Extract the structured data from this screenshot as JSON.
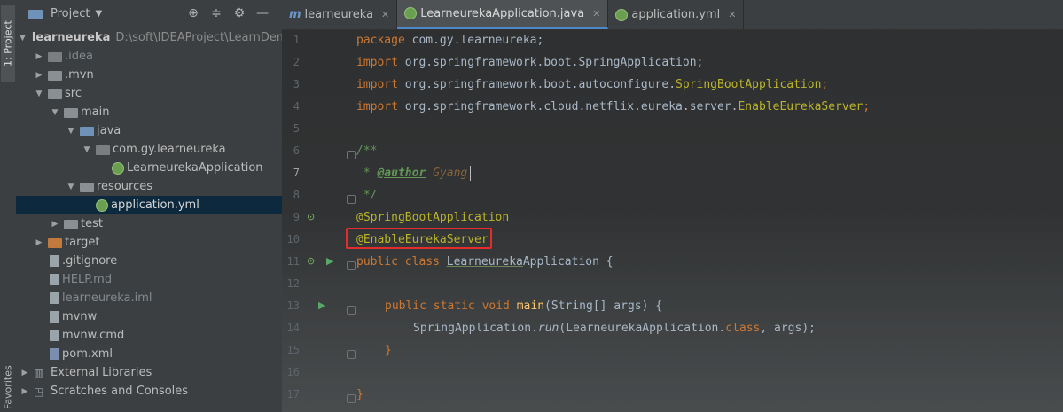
{
  "left_strip": {
    "project_tab": "1: Project",
    "favorites_tab": "Favorites"
  },
  "project_panel": {
    "title": "Project",
    "tree": [
      {
        "label": "learneureka",
        "path": "D:\\soft\\IDEAProject\\LearnDemo",
        "icon": "module-folder-icon"
      },
      {
        "label": ".idea",
        "icon": "folder-icon"
      },
      {
        "label": ".mvn",
        "icon": "folder-icon"
      },
      {
        "label": "src",
        "icon": "folder-icon"
      },
      {
        "label": "main",
        "icon": "folder-icon"
      },
      {
        "label": "java",
        "icon": "source-folder-icon"
      },
      {
        "label": "com.gy.learneureka",
        "icon": "package-icon"
      },
      {
        "label": "LearneurekaApplication",
        "icon": "spring-class-icon"
      },
      {
        "label": "resources",
        "icon": "resources-folder-icon"
      },
      {
        "label": "application.yml",
        "icon": "spring-config-icon"
      },
      {
        "label": "test",
        "icon": "folder-icon"
      },
      {
        "label": "target",
        "icon": "excluded-folder-icon"
      },
      {
        "label": ".gitignore",
        "icon": "gitignore-icon"
      },
      {
        "label": "HELP.md",
        "icon": "markdown-icon"
      },
      {
        "label": "learneureka.iml",
        "icon": "iml-icon"
      },
      {
        "label": "mvnw",
        "icon": "file-icon"
      },
      {
        "label": "mvnw.cmd",
        "icon": "file-icon"
      },
      {
        "label": "pom.xml",
        "icon": "maven-icon"
      },
      {
        "label": "External Libraries",
        "icon": "libraries-icon"
      },
      {
        "label": "Scratches and Consoles",
        "icon": "scratches-icon"
      }
    ]
  },
  "tabs": [
    {
      "label": "learneureka",
      "icon": "module-icon"
    },
    {
      "label": "LearneurekaApplication.java",
      "icon": "spring-class-icon"
    },
    {
      "label": "application.yml",
      "icon": "spring-config-icon"
    }
  ],
  "editor": {
    "line_numbers": [
      "1",
      "2",
      "3",
      "4",
      "5",
      "6",
      "7",
      "8",
      "9",
      "10",
      "11",
      "12",
      "13",
      "14",
      "15",
      "16",
      "17"
    ],
    "code": {
      "l1_kw": "package",
      "l1_rest": " com.gy.learneureka;",
      "l2_kw": "import",
      "l2_rest": " org.springframework.boot.SpringApplication;",
      "l3_kw": "import",
      "l3_rest": " org.springframework.boot.autoconfigure.",
      "l3_cls": "SpringBootApplication",
      "l3_end": ";",
      "l4_kw": "import",
      "l4_rest": " org.springframework.cloud.netflix.eureka.server.",
      "l4_cls": "EnableEurekaServer",
      "l4_end": ";",
      "l6": "/**",
      "l7_star": " * ",
      "l7_tag": "@author",
      "l7_val": " Gyang",
      "l8": " */",
      "l9": "@SpringBootApplication",
      "l10": "@EnableEurekaServer",
      "l11_kw": "public class ",
      "l11_name": "Learneureka",
      "l11_rest": "Application {",
      "l13_kw": "public static void ",
      "l13_fn": "main",
      "l13_rest": "(String[] args) {",
      "l14_a": "SpringApplication.",
      "l14_fn": "run",
      "l14_b": "(LearneurekaApplication.",
      "l14_kw": "class",
      "l14_c": ", args);",
      "l15": "}",
      "l17": "}"
    }
  }
}
